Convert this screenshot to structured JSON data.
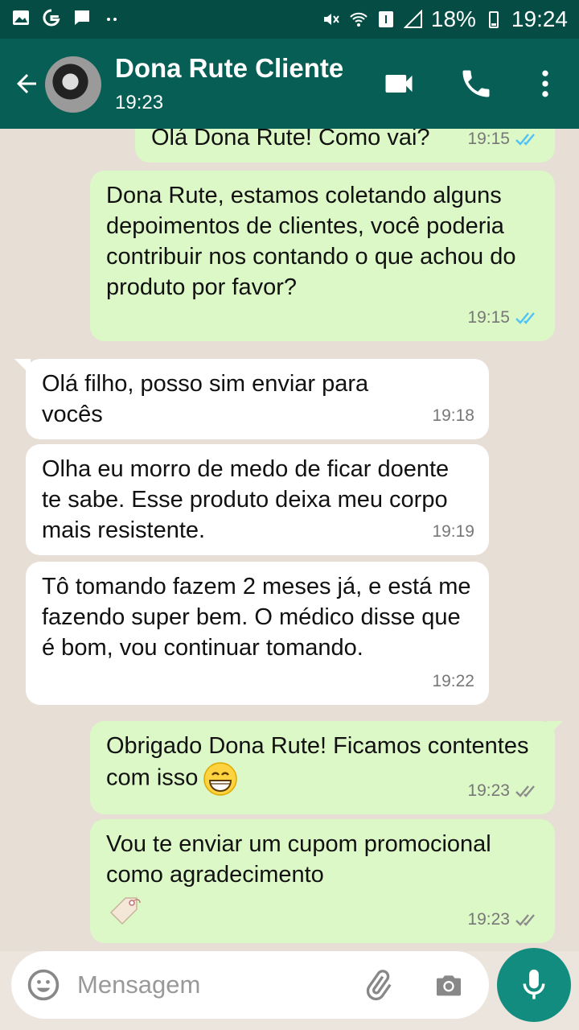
{
  "status_bar": {
    "battery_percent": "18%",
    "time": "19:24",
    "icons": [
      "image-icon",
      "google-icon",
      "chat-icon",
      "dots-icon",
      "mute-icon",
      "wifi-icon",
      "sim-1-icon",
      "signal-icon",
      "battery-icon"
    ]
  },
  "header": {
    "contact_name": "Dona Rute Cliente",
    "subtitle": "19:23",
    "icons": [
      "back-arrow-icon",
      "video-call-icon",
      "phone-icon",
      "more-vert-icon"
    ]
  },
  "messages": [
    {
      "dir": "out",
      "text": "Olá Dona Rute! Como vai?",
      "time": "19:15",
      "ticks": "read"
    },
    {
      "dir": "out",
      "text": "Dona Rute, estamos coletando alguns depoimentos de clientes, você poderia contribuir nos contando o que achou do produto por favor?",
      "time": "19:15",
      "ticks": "read"
    },
    {
      "dir": "in",
      "text": "Olá filho, posso sim enviar para vocês",
      "time": "19:18"
    },
    {
      "dir": "in",
      "text": "Olha eu morro de medo de ficar doente te sabe. Esse produto deixa meu corpo mais resistente.",
      "time": "19:19"
    },
    {
      "dir": "in",
      "text": "Tô tomando fazem 2 meses já, e está me fazendo super bem. O médico disse que é bom, vou continuar tomando.",
      "time": "19:22"
    },
    {
      "dir": "out",
      "text": "Obrigado Dona Rute! Ficamos contentes com isso",
      "time": "19:23",
      "ticks": "delivered",
      "emoji": "grinning-face"
    },
    {
      "dir": "out",
      "text": "Vou te enviar um cupom promocional como agradecimento",
      "time": "19:23",
      "ticks": "delivered",
      "emoji": "tag"
    }
  ],
  "input": {
    "placeholder": "Mensagem",
    "icons": [
      "emoji-icon",
      "attach-icon",
      "camera-icon",
      "mic-icon"
    ]
  },
  "colors": {
    "header": "#075E54",
    "status_bar": "#054D44",
    "outgoing_bubble": "#DCF8C6",
    "incoming_bubble": "#FFFFFF",
    "read_tick": "#4FC3F7",
    "delivered_tick": "#8C8C8C",
    "mic_button": "#128C7E"
  }
}
